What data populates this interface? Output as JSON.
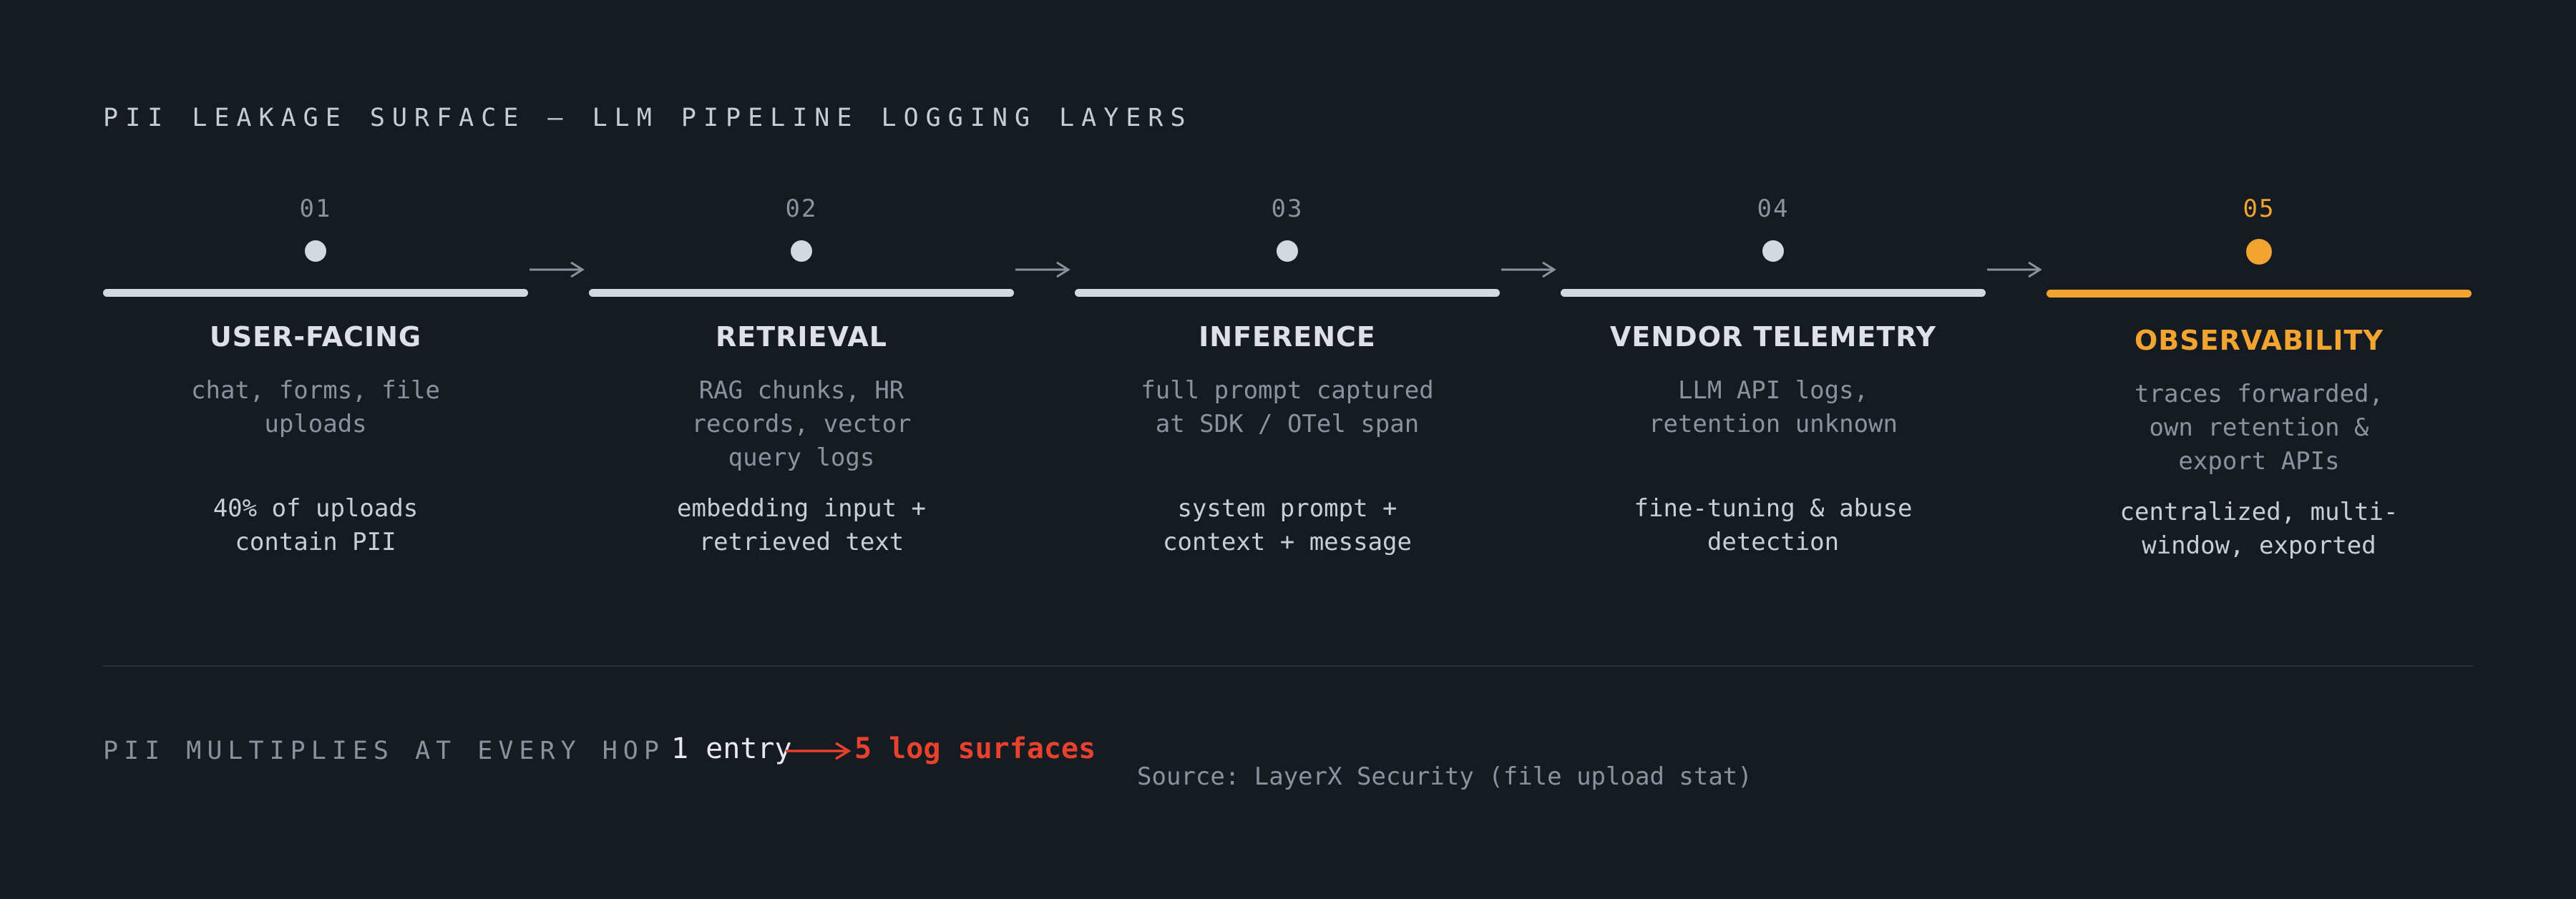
{
  "title": "PII LEAKAGE SURFACE — LLM PIPELINE LOGGING LAYERS",
  "stages": [
    {
      "num": "01",
      "name": "USER-FACING",
      "desc": "chat, forms, file uploads",
      "stat": "40% of uploads contain PII"
    },
    {
      "num": "02",
      "name": "RETRIEVAL",
      "desc": "RAG chunks, HR records, vector query logs",
      "stat": "embedding input + retrieved text"
    },
    {
      "num": "03",
      "name": "INFERENCE",
      "desc": "full prompt captured at SDK / OTel span",
      "stat": "system prompt + context + message"
    },
    {
      "num": "04",
      "name": "VENDOR TELEMETRY",
      "desc": "LLM API logs, retention unknown",
      "stat": "fine-tuning & abuse detection"
    },
    {
      "num": "05",
      "name": "OBSERVABILITY",
      "desc": "traces forwarded, own retention & export APIs",
      "stat": "centralized, multi-window, exported"
    }
  ],
  "footer": {
    "tagline": "PII MULTIPLIES AT EVERY HOP",
    "entry": "1 entry",
    "surfaces": "5 log surfaces",
    "source": "Source: LayerX Security (file upload stat)"
  },
  "colors": {
    "background": "#161b22",
    "neutral": "#d4d8df",
    "highlight": "#f2a431",
    "alert": "#e8412e",
    "muted": "#8b929c"
  },
  "icons": {
    "stage_marker": "dot-icon",
    "connector": "arrow-right-icon"
  }
}
